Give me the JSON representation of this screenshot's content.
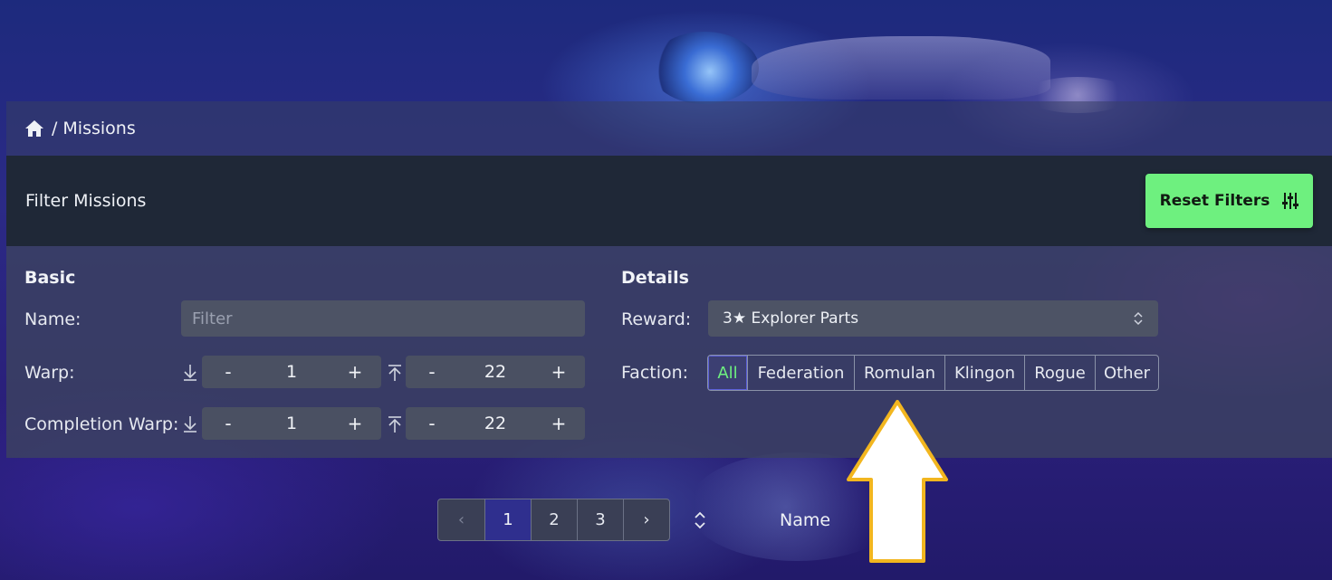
{
  "breadcrumb": {
    "separator": "/",
    "current": "Missions"
  },
  "header": {
    "title": "Filter Missions",
    "reset_label": "Reset Filters"
  },
  "basic": {
    "title": "Basic",
    "name_label": "Name:",
    "name_placeholder": "Filter",
    "name_value": "",
    "warp_label": "Warp:",
    "warp_min": "1",
    "warp_max": "22",
    "completion_label": "Completion Warp:",
    "completion_min": "1",
    "completion_max": "22",
    "minus": "-",
    "plus": "+"
  },
  "details": {
    "title": "Details",
    "reward_label": "Reward:",
    "reward_value": "3★ Explorer Parts",
    "faction_label": "Faction:",
    "factions": [
      "All",
      "Federation",
      "Romulan",
      "Klingon",
      "Rogue",
      "Other"
    ],
    "active_faction": "All"
  },
  "pagination": {
    "pages": [
      "1",
      "2",
      "3"
    ],
    "current": "1",
    "prev": "‹",
    "next": "›"
  },
  "sort": {
    "label": "Name"
  },
  "colors": {
    "accent": "#6ef07f",
    "highlight_arrow": "#f2b61f"
  }
}
